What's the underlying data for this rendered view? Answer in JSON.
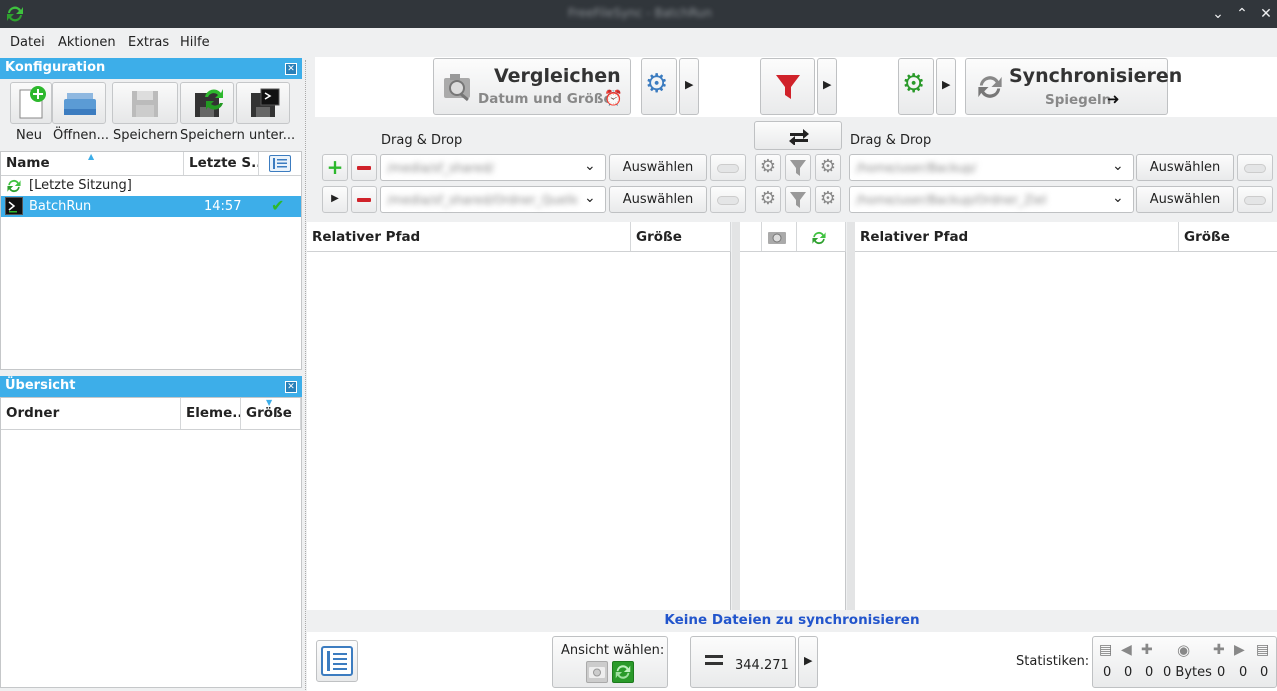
{
  "window": {
    "title": "FreeFileSync - BatchRun"
  },
  "menu": {
    "items": [
      "Datei",
      "Aktionen",
      "Extras",
      "Hilfe"
    ]
  },
  "config_panel": {
    "title": "Konfiguration",
    "tools": [
      "Neu",
      "Öffnen...",
      "Speichern",
      "Speichern unter..."
    ],
    "columns": {
      "name": "Name",
      "last": "Letzte S..."
    },
    "rows": [
      {
        "name": "[Letzte Sitzung]",
        "time": ""
      },
      {
        "name": "BatchRun",
        "time": "14:57"
      }
    ]
  },
  "overview_panel": {
    "title": "Übersicht",
    "columns": {
      "folder": "Ordner",
      "items": "Eleme...",
      "size": "Größe"
    }
  },
  "compare": {
    "label": "Vergleichen",
    "sub": "Datum und Größe"
  },
  "sync": {
    "label": "Synchronisieren",
    "sub": "Spiegeln"
  },
  "left": {
    "dragdrop": "Drag & Drop",
    "select1": "Auswählen",
    "select2": "Auswählen",
    "path1": "/media/sf_shared/",
    "path2": "/media/sf_shared/Ordner_Quelle"
  },
  "right": {
    "dragdrop": "Drag & Drop",
    "select1": "Auswählen",
    "select2": "Auswählen",
    "path1": "/home/user/Backup/",
    "path2": "/home/user/Backup/Ordner_Ziel"
  },
  "grid": {
    "left_cols": {
      "path": "Relativer Pfad",
      "size": "Größe"
    },
    "right_cols": {
      "path": "Relativer Pfad",
      "size": "Größe"
    }
  },
  "status": {
    "message": "Keine Dateien zu synchronisieren"
  },
  "bottom": {
    "view_label": "Ansicht wählen:",
    "count": "344.271",
    "stats_label": "Statistiken:",
    "stats": [
      "0",
      "0",
      "0",
      "0 Bytes",
      "0",
      "0",
      "0"
    ]
  },
  "colors": {
    "accent": "#3daee9",
    "status_text": "#2255cc"
  }
}
